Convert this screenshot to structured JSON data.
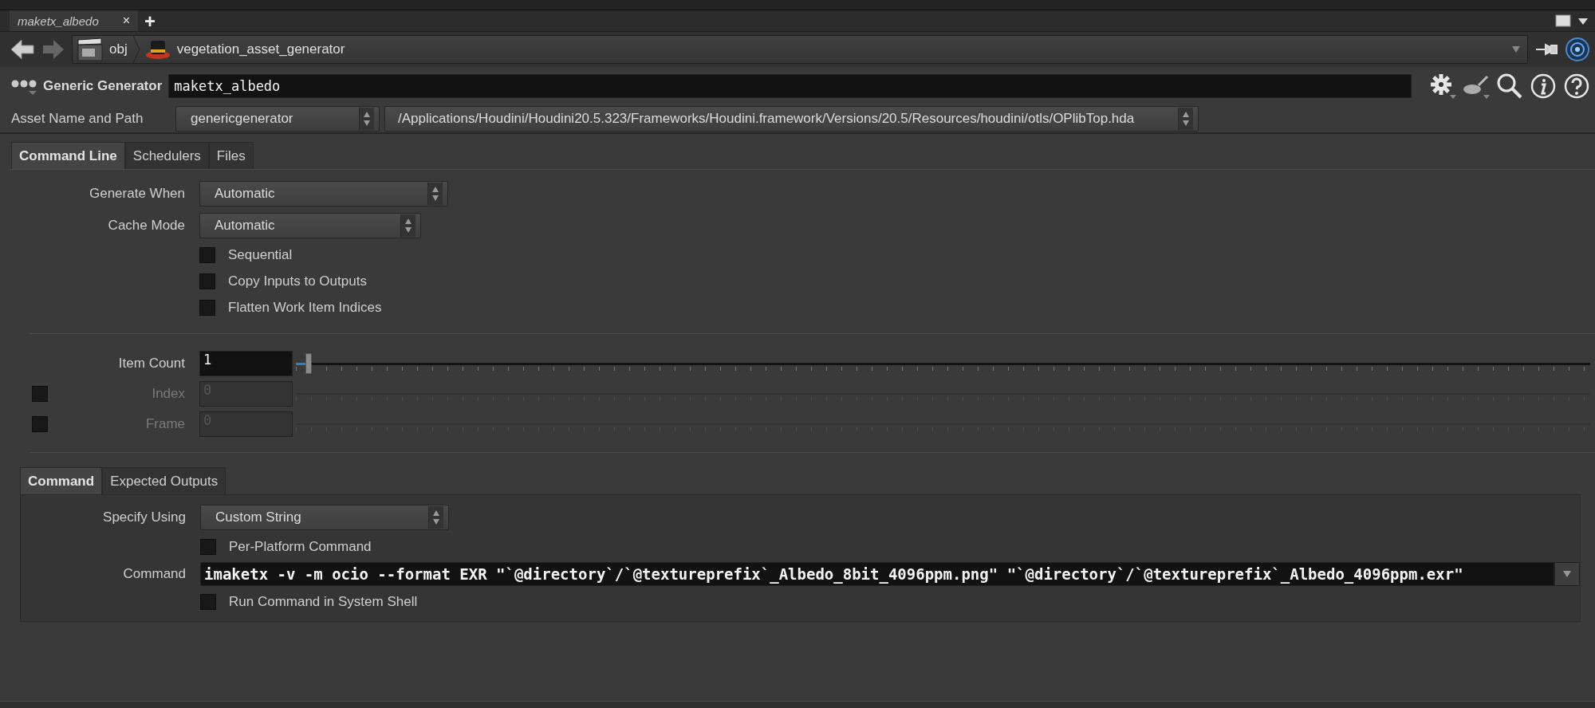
{
  "editor_tabs": [
    {
      "label": "maketx_albedo",
      "selected": true,
      "close": "×"
    }
  ],
  "add_tab": "+",
  "path_bar": {
    "crumbs": [
      "obj",
      "vegetation_asset_generator"
    ]
  },
  "node_header": {
    "type_label": "Generic Generator",
    "name": "maketx_albedo"
  },
  "asset": {
    "label": "Asset Name and Path",
    "name": "genericgenerator",
    "path": "/Applications/Houdini/Houdini20.5.323/Frameworks/Houdini.framework/Versions/20.5/Resources/houdini/otls/OPlibTop.hda"
  },
  "tabs": [
    {
      "label": "Command Line",
      "selected": true
    },
    {
      "label": "Schedulers",
      "selected": false
    },
    {
      "label": "Files",
      "selected": false
    }
  ],
  "params": [
    {
      "kind": "menu",
      "label": "Generate When",
      "value": "Automatic"
    },
    {
      "kind": "menu",
      "label": "Cache Mode",
      "value": "Automatic"
    },
    {
      "kind": "checkbox",
      "label": "Sequential",
      "checked": false
    },
    {
      "kind": "checkbox",
      "label": "Copy Inputs to Outputs",
      "checked": false
    },
    {
      "kind": "checkbox",
      "label": "Flatten Work Item Indices",
      "checked": false
    }
  ],
  "ranges": [
    {
      "label": "Item Count",
      "value": "1",
      "level": 0.01,
      "disabled": false
    },
    {
      "label": "Index",
      "value": "0",
      "disabled": true,
      "checked": false
    },
    {
      "label": "Frame",
      "value": "0",
      "disabled": true,
      "checked": false
    }
  ],
  "command_tabs": [
    {
      "label": "Command",
      "selected": true
    },
    {
      "label": "Expected Outputs",
      "selected": false
    }
  ],
  "command_params": [
    {
      "kind": "menu",
      "label": "Specify Using",
      "value": "Custom String"
    },
    {
      "kind": "checkbox",
      "label": "Per-Platform Command",
      "checked": false
    },
    {
      "kind": "string",
      "label": "Command",
      "value": "imaketx -v -m ocio --format EXR \"`@directory`/`@textureprefix`_Albedo_8bit_4096ppm.png\" \"`@directory`/`@textureprefix`_Albedo_4096ppm.exr\""
    },
    {
      "kind": "checkbox",
      "label": "Run Command in System Shell",
      "checked": false
    }
  ]
}
